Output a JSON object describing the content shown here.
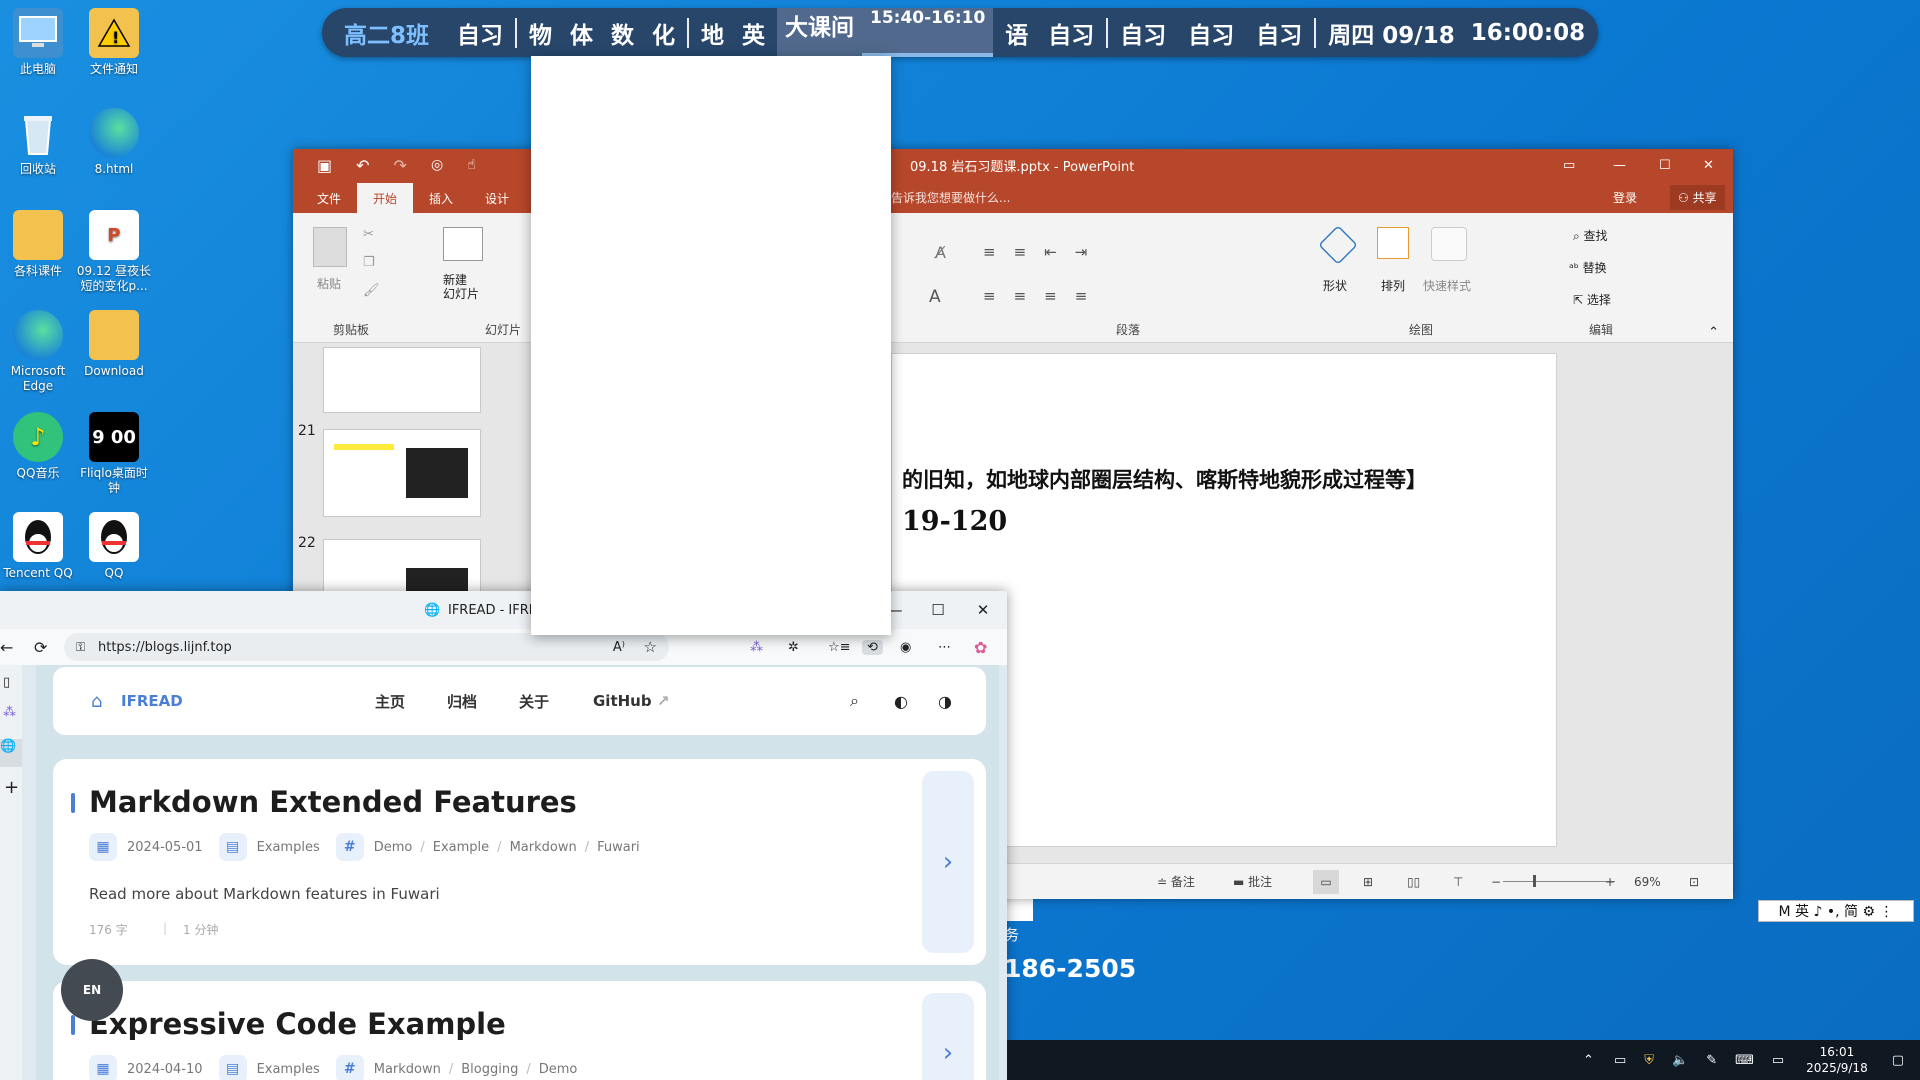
{
  "desktop": {
    "icons": [
      {
        "label": "此电脑",
        "icon": "computer-icon",
        "color": "#5aa9e6"
      },
      {
        "label": "文件通知",
        "icon": "folder-warning-icon",
        "color": "#f2c14e"
      },
      {
        "label": "回收站",
        "icon": "recycle-bin-icon",
        "color": "#cfe3f2"
      },
      {
        "label": "8.html",
        "icon": "edge-icon",
        "color": "#2d9de0"
      },
      {
        "label": "各科课件",
        "icon": "folder-icon",
        "color": "#f2c14e"
      },
      {
        "label": "09.12 昼夜长短的变化p...",
        "icon": "pptx-file-icon",
        "color": "#d24726"
      },
      {
        "label": "Microsoft Edge",
        "icon": "edge-icon",
        "color": "#2d9de0"
      },
      {
        "label": "Download",
        "icon": "folder-icon",
        "color": "#f2c14e"
      },
      {
        "label": "QQ音乐",
        "icon": "qq-music-icon",
        "color": "#31c27c"
      },
      {
        "label": "Fliqlo桌面时钟",
        "icon": "clock-icon",
        "color": "#000000"
      },
      {
        "label": "Tencent QQ",
        "icon": "qq-icon",
        "color": "#111111"
      },
      {
        "label": "QQ",
        "icon": "qq-icon",
        "color": "#111111"
      }
    ]
  },
  "schedule": {
    "class_name": "高二8班",
    "items_before": [
      "自习"
    ],
    "items_group": [
      "物",
      "体",
      "数",
      "化"
    ],
    "items_group2": [
      "地",
      "英"
    ],
    "current": "大课间",
    "time_range": "15:40-16:10",
    "items_after1": [
      "语",
      "自习"
    ],
    "items_after2": [
      "自习",
      "自习",
      "自习"
    ],
    "weekday_date": "周四 09/18",
    "clock": "16:00:08"
  },
  "ppt": {
    "title": "09.18 岩石习题课.pptx - PowerPoint",
    "tell_me": "告诉我您想要做什么...",
    "signin": "登录",
    "share": "共享",
    "tabs": [
      "文件",
      "开始",
      "插入",
      "设计"
    ],
    "ribbon": {
      "paste": "粘贴",
      "new_slide": "新建\n幻灯片",
      "group_clipboard": "剪贴板",
      "group_slides": "幻灯片",
      "group_paragraph": "段落",
      "group_drawing": "绘图",
      "group_edit": "编辑",
      "shape": "形状",
      "arrange": "排列",
      "quick_style": "快速样式",
      "find": "查找",
      "replace": "替换",
      "select": "选择"
    },
    "slide_numbers": [
      "21",
      "22"
    ],
    "slide_line1": "的旧知，如地球内部圈层结构、喀斯特地貌形成过程等】",
    "slide_line2": "19-120",
    "status": {
      "notes": "备注",
      "comments": "批注",
      "zoom": "69%"
    }
  },
  "behind_window": {
    "text1": "务",
    "text2": "186-2505"
  },
  "browser": {
    "title": "IFREAD - IFREAD",
    "url": "https://blogs.lijnf.top",
    "site_name": "IFREAD",
    "nav": [
      "主页",
      "归档",
      "关于",
      "GitHub"
    ],
    "posts": [
      {
        "title": "Markdown Extended Features",
        "date": "2024-05-01",
        "category": "Examples",
        "tags": [
          "Demo",
          "Example",
          "Markdown",
          "Fuwari"
        ],
        "desc": "Read more about Markdown features in Fuwari",
        "words": "176 字",
        "time": "1 分钟"
      },
      {
        "title": "Expressive Code Example",
        "date": "2024-04-10",
        "category": "Examples",
        "tags": [
          "Markdown",
          "Blogging",
          "Demo"
        ]
      }
    ],
    "lang_button": "EN"
  },
  "ime": {
    "text": "M 英 ♪ •, 简 ⚙ ⋮"
  },
  "taskbar": {
    "time": "16:01",
    "date": "2025/9/18"
  }
}
